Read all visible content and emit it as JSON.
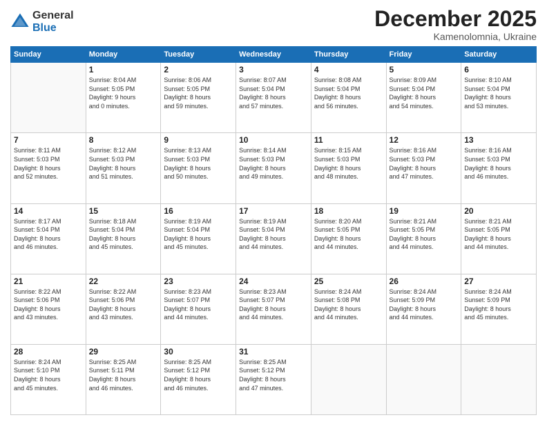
{
  "logo": {
    "general": "General",
    "blue": "Blue"
  },
  "header": {
    "month": "December 2025",
    "location": "Kamenolomnia, Ukraine"
  },
  "days": [
    "Sunday",
    "Monday",
    "Tuesday",
    "Wednesday",
    "Thursday",
    "Friday",
    "Saturday"
  ],
  "weeks": [
    [
      {
        "day": "",
        "info": ""
      },
      {
        "day": "1",
        "info": "Sunrise: 8:04 AM\nSunset: 5:05 PM\nDaylight: 9 hours\nand 0 minutes."
      },
      {
        "day": "2",
        "info": "Sunrise: 8:06 AM\nSunset: 5:05 PM\nDaylight: 8 hours\nand 59 minutes."
      },
      {
        "day": "3",
        "info": "Sunrise: 8:07 AM\nSunset: 5:04 PM\nDaylight: 8 hours\nand 57 minutes."
      },
      {
        "day": "4",
        "info": "Sunrise: 8:08 AM\nSunset: 5:04 PM\nDaylight: 8 hours\nand 56 minutes."
      },
      {
        "day": "5",
        "info": "Sunrise: 8:09 AM\nSunset: 5:04 PM\nDaylight: 8 hours\nand 54 minutes."
      },
      {
        "day": "6",
        "info": "Sunrise: 8:10 AM\nSunset: 5:04 PM\nDaylight: 8 hours\nand 53 minutes."
      }
    ],
    [
      {
        "day": "7",
        "info": "Sunrise: 8:11 AM\nSunset: 5:03 PM\nDaylight: 8 hours\nand 52 minutes."
      },
      {
        "day": "8",
        "info": "Sunrise: 8:12 AM\nSunset: 5:03 PM\nDaylight: 8 hours\nand 51 minutes."
      },
      {
        "day": "9",
        "info": "Sunrise: 8:13 AM\nSunset: 5:03 PM\nDaylight: 8 hours\nand 50 minutes."
      },
      {
        "day": "10",
        "info": "Sunrise: 8:14 AM\nSunset: 5:03 PM\nDaylight: 8 hours\nand 49 minutes."
      },
      {
        "day": "11",
        "info": "Sunrise: 8:15 AM\nSunset: 5:03 PM\nDaylight: 8 hours\nand 48 minutes."
      },
      {
        "day": "12",
        "info": "Sunrise: 8:16 AM\nSunset: 5:03 PM\nDaylight: 8 hours\nand 47 minutes."
      },
      {
        "day": "13",
        "info": "Sunrise: 8:16 AM\nSunset: 5:03 PM\nDaylight: 8 hours\nand 46 minutes."
      }
    ],
    [
      {
        "day": "14",
        "info": "Sunrise: 8:17 AM\nSunset: 5:04 PM\nDaylight: 8 hours\nand 46 minutes."
      },
      {
        "day": "15",
        "info": "Sunrise: 8:18 AM\nSunset: 5:04 PM\nDaylight: 8 hours\nand 45 minutes."
      },
      {
        "day": "16",
        "info": "Sunrise: 8:19 AM\nSunset: 5:04 PM\nDaylight: 8 hours\nand 45 minutes."
      },
      {
        "day": "17",
        "info": "Sunrise: 8:19 AM\nSunset: 5:04 PM\nDaylight: 8 hours\nand 44 minutes."
      },
      {
        "day": "18",
        "info": "Sunrise: 8:20 AM\nSunset: 5:05 PM\nDaylight: 8 hours\nand 44 minutes."
      },
      {
        "day": "19",
        "info": "Sunrise: 8:21 AM\nSunset: 5:05 PM\nDaylight: 8 hours\nand 44 minutes."
      },
      {
        "day": "20",
        "info": "Sunrise: 8:21 AM\nSunset: 5:05 PM\nDaylight: 8 hours\nand 44 minutes."
      }
    ],
    [
      {
        "day": "21",
        "info": "Sunrise: 8:22 AM\nSunset: 5:06 PM\nDaylight: 8 hours\nand 43 minutes."
      },
      {
        "day": "22",
        "info": "Sunrise: 8:22 AM\nSunset: 5:06 PM\nDaylight: 8 hours\nand 43 minutes."
      },
      {
        "day": "23",
        "info": "Sunrise: 8:23 AM\nSunset: 5:07 PM\nDaylight: 8 hours\nand 44 minutes."
      },
      {
        "day": "24",
        "info": "Sunrise: 8:23 AM\nSunset: 5:07 PM\nDaylight: 8 hours\nand 44 minutes."
      },
      {
        "day": "25",
        "info": "Sunrise: 8:24 AM\nSunset: 5:08 PM\nDaylight: 8 hours\nand 44 minutes."
      },
      {
        "day": "26",
        "info": "Sunrise: 8:24 AM\nSunset: 5:09 PM\nDaylight: 8 hours\nand 44 minutes."
      },
      {
        "day": "27",
        "info": "Sunrise: 8:24 AM\nSunset: 5:09 PM\nDaylight: 8 hours\nand 45 minutes."
      }
    ],
    [
      {
        "day": "28",
        "info": "Sunrise: 8:24 AM\nSunset: 5:10 PM\nDaylight: 8 hours\nand 45 minutes."
      },
      {
        "day": "29",
        "info": "Sunrise: 8:25 AM\nSunset: 5:11 PM\nDaylight: 8 hours\nand 46 minutes."
      },
      {
        "day": "30",
        "info": "Sunrise: 8:25 AM\nSunset: 5:12 PM\nDaylight: 8 hours\nand 46 minutes."
      },
      {
        "day": "31",
        "info": "Sunrise: 8:25 AM\nSunset: 5:12 PM\nDaylight: 8 hours\nand 47 minutes."
      },
      {
        "day": "",
        "info": ""
      },
      {
        "day": "",
        "info": ""
      },
      {
        "day": "",
        "info": ""
      }
    ]
  ]
}
